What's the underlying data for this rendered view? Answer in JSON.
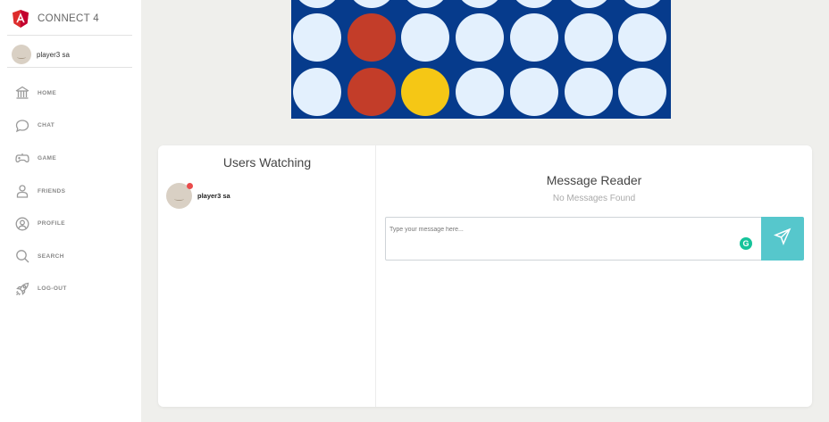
{
  "app": {
    "title": "CONNECT 4",
    "brand_color": "#dd2c2c"
  },
  "user": {
    "name": "player3 sa"
  },
  "nav": [
    {
      "label": "HOME",
      "icon": "home-icon"
    },
    {
      "label": "CHAT",
      "icon": "chat-icon"
    },
    {
      "label": "GAME",
      "icon": "gamepad-icon"
    },
    {
      "label": "FRIENDS",
      "icon": "user-icon"
    },
    {
      "label": "PROFILE",
      "icon": "profile-icon"
    },
    {
      "label": "SEARCH",
      "icon": "search-icon"
    },
    {
      "label": "LOG-OUT",
      "icon": "rocket-icon"
    }
  ],
  "board": {
    "colors": {
      "board": "#063b8c",
      "empty": "#e3f0fd",
      "red": "#c33d29",
      "yellow": "#f5c715"
    },
    "visible_rows": [
      [
        "empty",
        "red",
        "empty",
        "empty",
        "empty",
        "empty",
        "empty"
      ],
      [
        "empty",
        "red",
        "yellow",
        "empty",
        "empty",
        "empty",
        "empty"
      ]
    ]
  },
  "watching": {
    "title": "Users Watching",
    "users": [
      {
        "name": "player3 sa",
        "online": true
      }
    ]
  },
  "messages": {
    "title": "Message Reader",
    "empty_text": "No Messages Found",
    "input_placeholder": "Type your message here...",
    "input_value": ""
  }
}
